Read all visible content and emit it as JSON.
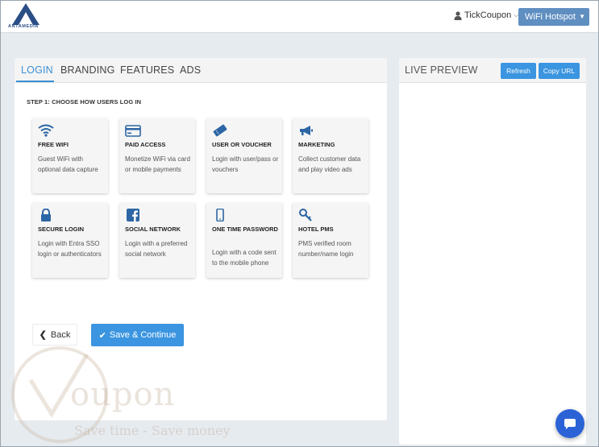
{
  "header": {
    "logo_text": "ANTAMEDIA",
    "user_label": "TickCoupon",
    "hotspot_selected": "WiFi Hotspot"
  },
  "tabs": [
    {
      "label": "LOGIN",
      "active": true
    },
    {
      "label": "BRANDING",
      "active": false
    },
    {
      "label": "FEATURES",
      "active": false
    },
    {
      "label": "ADS",
      "active": false
    }
  ],
  "step_title": "STEP 1: CHOOSE HOW USERS LOG IN",
  "options": [
    {
      "title": "FREE WIFI",
      "desc": "Guest WiFi with optional data capture",
      "icon": "wifi-icon"
    },
    {
      "title": "PAID ACCESS",
      "desc": "Monetize WiFi via card or mobile payments",
      "icon": "credit-card-icon"
    },
    {
      "title": "USER OR VOUCHER",
      "desc": "Login with user/pass or vouchers",
      "icon": "ticket-icon"
    },
    {
      "title": "MARKETING",
      "desc": "Collect customer data and play video ads",
      "icon": "megaphone-icon"
    },
    {
      "title": "SECURE LOGIN",
      "desc": "Login with Entra SSO login or authenticators",
      "icon": "lock-icon"
    },
    {
      "title": "SOCIAL NETWORK",
      "desc": "Login with a preferred social network",
      "icon": "facebook-icon"
    },
    {
      "title": "ONE TIME PASSWORD",
      "desc": "Login with a code sent to the mobile phone",
      "icon": "mobile-phone-icon"
    },
    {
      "title": "HOTEL PMS",
      "desc": "PMS verified room number/name login",
      "icon": "key-icon"
    }
  ],
  "buttons": {
    "back": "Back",
    "save": "Save & Continue"
  },
  "preview": {
    "title": "LIVE PREVIEW",
    "refresh": "Refresh",
    "copy_url": "Copy URL"
  },
  "watermark": {
    "word": "oupon",
    "slogan": "Save time - Save money"
  },
  "colors": {
    "accent": "#3b95e0",
    "tab_active": "#3b8fd6",
    "icon": "#2c66a4",
    "select_bg": "#5f8fc1",
    "chat": "#2b63d6"
  }
}
